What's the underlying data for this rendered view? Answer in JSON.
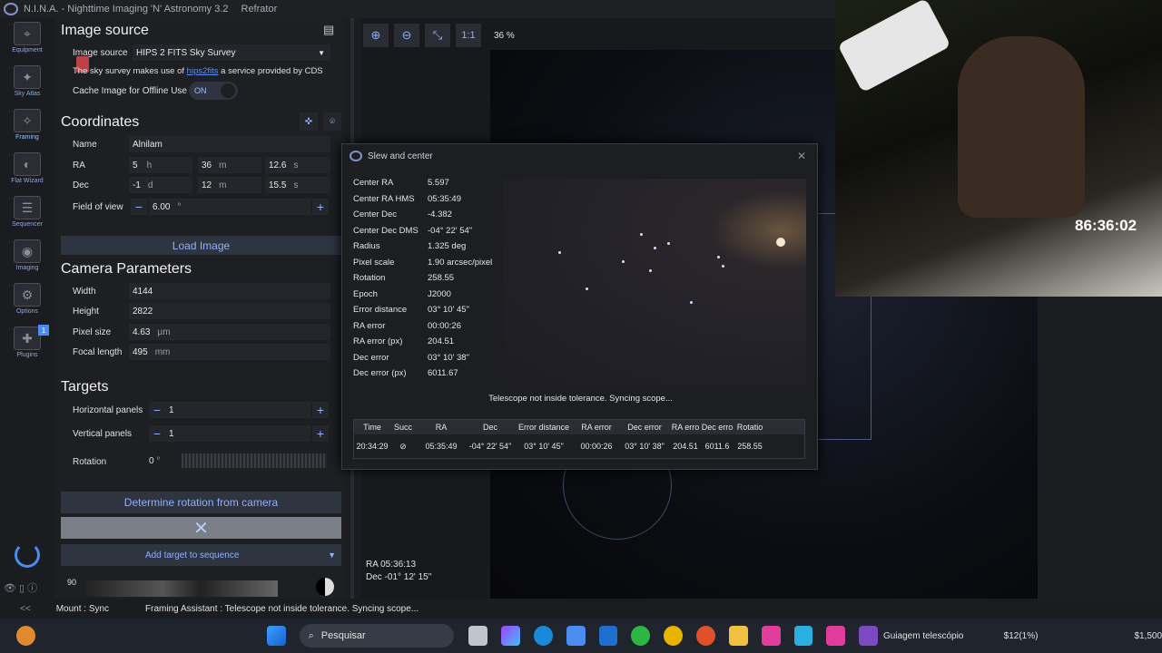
{
  "app": {
    "title": "N.I.N.A. - Nighttime Imaging 'N' Astronomy 3.2",
    "profile": "Refrator"
  },
  "rail": [
    {
      "label": "Equipment",
      "icon": "telescope-icon"
    },
    {
      "label": "Sky Atlas",
      "icon": "sky-atlas-icon"
    },
    {
      "label": "Framing",
      "icon": "framing-icon"
    },
    {
      "label": "Flat Wizard",
      "icon": "flat-wizard-icon"
    },
    {
      "label": "Sequencer",
      "icon": "sequencer-icon"
    },
    {
      "label": "Imaging",
      "icon": "imaging-icon"
    },
    {
      "label": "Options",
      "icon": "gear-icon"
    },
    {
      "label": "Plugins",
      "icon": "puzzle-icon",
      "badge": "1"
    }
  ],
  "image_source": {
    "heading": "Image source",
    "label": "Image source",
    "value": "HIPS 2 FITS Sky Survey",
    "info_pre": "The sky survey makes use of",
    "info_link": "hips2fits",
    "info_post": "a service provided by CDS",
    "cache_label": "Cache Image for Offline Use",
    "cache_state": "ON"
  },
  "coordinates": {
    "heading": "Coordinates",
    "name_label": "Name",
    "name": "Alnilam",
    "ra_label": "RA",
    "ra_h": "5",
    "ra_h_unit": "h",
    "ra_m": "36",
    "ra_m_unit": "m",
    "ra_s": "12.6",
    "ra_s_unit": "s",
    "dec_label": "Dec",
    "dec_d": "-1",
    "dec_d_unit": "d",
    "dec_m": "12",
    "dec_m_unit": "m",
    "dec_s": "15.5",
    "dec_s_unit": "s",
    "fov_label": "Field of view",
    "fov": "6.00",
    "fov_unit": "°",
    "load_button": "Load Image"
  },
  "camera": {
    "heading": "Camera Parameters",
    "width_label": "Width",
    "width": "4144",
    "height_label": "Height",
    "height": "2822",
    "pixel_label": "Pixel size",
    "pixel": "4.63",
    "pixel_unit": "µm",
    "focal_label": "Focal length",
    "focal": "495",
    "focal_unit": "mm"
  },
  "targets": {
    "heading": "Targets",
    "hpanels_label": "Horizontal panels",
    "hpanels": "1",
    "vpanels_label": "Vertical panels",
    "vpanels": "1",
    "rotation_label": "Rotation",
    "rotation": "0",
    "rotation_unit": "°",
    "determine_button": "Determine rotation from camera",
    "add_button": "Add target to sequence",
    "opacity_value": "90"
  },
  "map": {
    "zoom_label": "1:1",
    "zoom_pct": "36 %",
    "ra_readout": "RA  05:36:13",
    "dec_readout": "Dec  -01° 12' 15\""
  },
  "dialog": {
    "title": "Slew and center",
    "fields": [
      {
        "k": "Center RA",
        "v": "5.597"
      },
      {
        "k": "Center RA HMS",
        "v": "05:35:49"
      },
      {
        "k": "Center Dec",
        "v": "-4.382"
      },
      {
        "k": "Center Dec DMS",
        "v": "-04° 22' 54\""
      },
      {
        "k": "Radius",
        "v": "1.325 deg"
      },
      {
        "k": "Pixel scale",
        "v": "1.90 arcsec/pixel"
      },
      {
        "k": "Rotation",
        "v": "258.55"
      },
      {
        "k": "Epoch",
        "v": "J2000"
      },
      {
        "k": "Error distance",
        "v": "03° 10' 45\""
      },
      {
        "k": "RA error",
        "v": "00:00:26"
      },
      {
        "k": "RA error (px)",
        "v": "204.51"
      },
      {
        "k": "Dec error",
        "v": "03° 10' 38\""
      },
      {
        "k": "Dec error (px)",
        "v": "6011.67"
      }
    ],
    "status": "Telescope not inside tolerance. Syncing scope...",
    "table_headers": [
      "Time",
      "Succ",
      "RA",
      "Dec",
      "Error distance",
      "RA error",
      "Dec error",
      "RA erro",
      "Dec erro",
      "Rotatio"
    ],
    "table_row": [
      "20:34:29",
      "",
      "05:35:49",
      "-04° 22' 54\"",
      "03° 10' 45\"",
      "00:00:26",
      "03° 10' 38\"",
      "204.51",
      "6011.6",
      "258.55"
    ]
  },
  "webcam": {
    "time": "86:36:02"
  },
  "status": {
    "mount": "Mount :  Sync",
    "framing": "Framing Assistant :  Telescope not inside tolerance. Syncing scope..."
  },
  "taskbar": {
    "search": "Pesquisar",
    "active_app": "Guiagem telescópio",
    "price1": "$12(1%)",
    "price2": "$1,500"
  }
}
